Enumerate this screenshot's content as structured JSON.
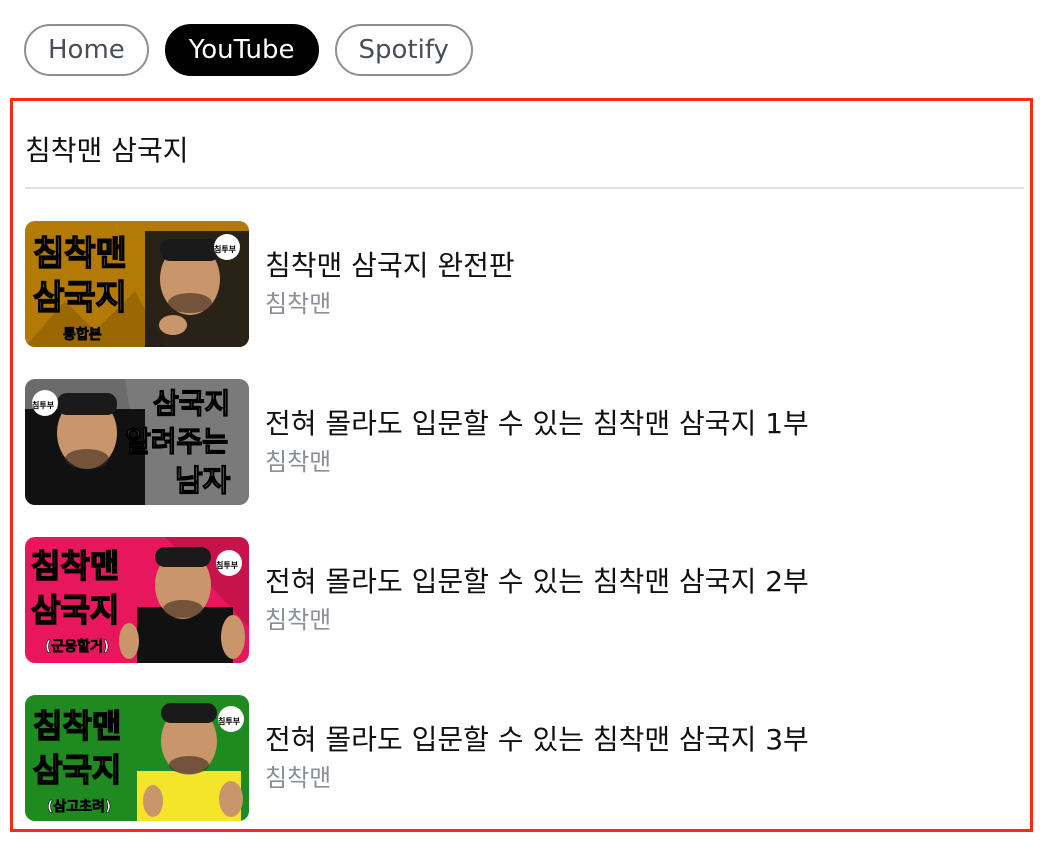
{
  "tabs": [
    {
      "label": "Home",
      "active": false
    },
    {
      "label": "YouTube",
      "active": true
    },
    {
      "label": "Spotify",
      "active": false
    }
  ],
  "panel": {
    "title": "침착맨 삼국지",
    "border_color": "#ff2a12"
  },
  "videos": [
    {
      "title": "침착맨 삼국지 완전판",
      "channel": "침착맨",
      "thumbnail": {
        "bg": "#b37a06",
        "text_lines": [
          "침착맨",
          "삼국지"
        ],
        "subtext": "통합본",
        "badge": "침투부"
      }
    },
    {
      "title": "전혀 몰라도 입문할 수 있는 침착맨 삼국지 1부",
      "channel": "침착맨",
      "thumbnail": {
        "bg": "#6b6b6b",
        "text_lines": [
          "삼국지",
          "알려주는",
          "남자"
        ],
        "subtext": "",
        "badge": "침투부"
      }
    },
    {
      "title": "전혀 몰라도 입문할 수 있는 침착맨 삼국지 2부",
      "channel": "침착맨",
      "thumbnail": {
        "bg": "#e8175d",
        "text_lines": [
          "침착맨",
          "삼국지"
        ],
        "subtext": "(군웅할거)",
        "badge": "침투부"
      }
    },
    {
      "title": "전혀 몰라도 입문할 수 있는 침착맨 삼국지 3부",
      "channel": "침착맨",
      "thumbnail": {
        "bg": "#1f8a1f",
        "text_lines": [
          "침착맨",
          "삼국지"
        ],
        "subtext": "(삼고초려)",
        "badge": "침투부"
      }
    }
  ]
}
